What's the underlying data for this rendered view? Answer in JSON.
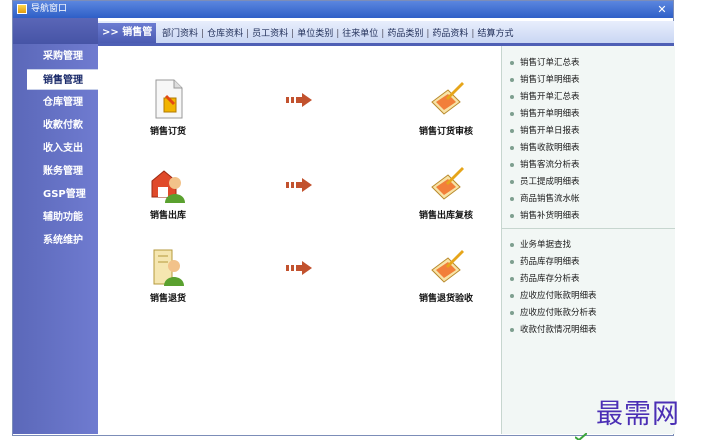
{
  "window": {
    "title": "导航窗口",
    "close_glyph": "✕"
  },
  "sidebar": {
    "items": [
      {
        "label": "采购管理"
      },
      {
        "label": "销售管理"
      },
      {
        "label": "仓库管理"
      },
      {
        "label": "收款付款"
      },
      {
        "label": "收入支出"
      },
      {
        "label": "账务管理"
      },
      {
        "label": "GSP管理"
      },
      {
        "label": "辅助功能"
      },
      {
        "label": "系统维护"
      }
    ],
    "active_index": 1
  },
  "tabbar": {
    "active_label": ">> 销售管理",
    "links": [
      "部门资料",
      "仓库资料",
      "员工资料",
      "单位类别",
      "往来单位",
      "药品类别",
      "药品资料",
      "结算方式"
    ],
    "separator": "|"
  },
  "flow": {
    "rows": [
      {
        "left": {
          "label": "销售订货",
          "icon": "order-icon"
        },
        "right": {
          "label": "销售订货审核",
          "icon": "review-pencil-icon"
        }
      },
      {
        "left": {
          "label": "销售出库",
          "icon": "warehouse-person-icon"
        },
        "right": {
          "label": "销售出库复核",
          "icon": "review-pencil-icon"
        }
      },
      {
        "left": {
          "label": "销售退货",
          "icon": "return-person-icon"
        },
        "right": {
          "label": "销售退货验收",
          "icon": "review-pencil-icon"
        }
      }
    ],
    "arrow_icon": "right-arrow-icon"
  },
  "reports": {
    "group1": [
      "销售订单汇总表",
      "销售订单明细表",
      "销售开单汇总表",
      "销售开单明细表",
      "销售开单日报表",
      "销售收款明细表",
      "销售客流分析表",
      "员工提成明细表",
      "商品销售流水帐",
      "销售补货明细表"
    ],
    "group2": [
      "业务单据查找",
      "药品库存明细表",
      "药品库存分析表",
      "应收应付账款明细表",
      "应收应付账款分析表",
      "收款付款情况明细表"
    ]
  },
  "watermark": "最需网",
  "colors": {
    "sidebar": "#6f7bd0",
    "tab_accent": "#4e5fb5",
    "panel_bg": "#f2f7f5",
    "arrow": "#c2522e",
    "watermark": "#4b2fb5"
  }
}
